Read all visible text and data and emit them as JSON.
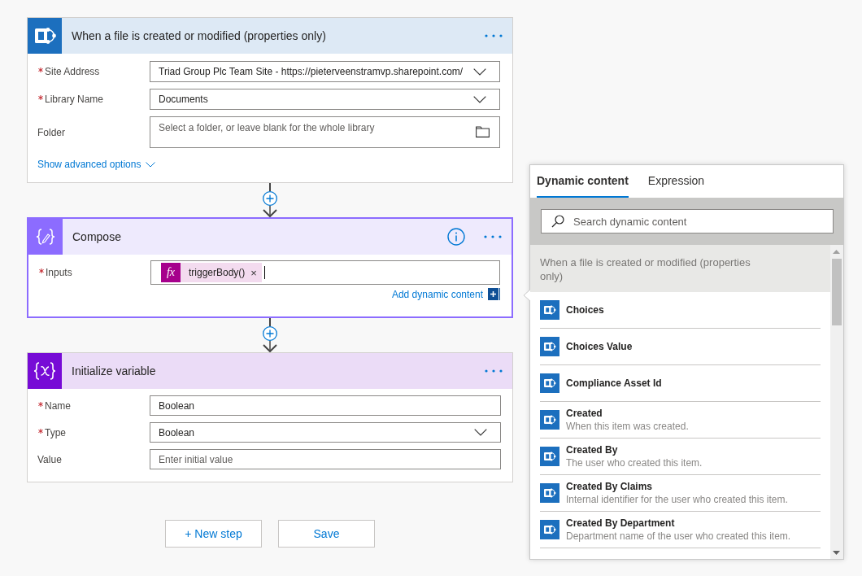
{
  "steps": [
    {
      "kind": "sharepoint",
      "title": "When a file is created or modified (properties only)",
      "selected": false,
      "fields": [
        {
          "kind": "dropdown",
          "label": "Site Address",
          "required": true,
          "value": "Triad Group Plc Team Site - https://pieterveenstramvp.sharepoint.com/"
        },
        {
          "kind": "dropdown",
          "label": "Library Name",
          "required": true,
          "value": "Documents"
        },
        {
          "kind": "folder",
          "label": "Folder",
          "required": false,
          "placeholder": "Select a folder, or leave blank for the whole library"
        }
      ],
      "link": "Show advanced options"
    },
    {
      "kind": "compose",
      "title": "Compose",
      "selected": true,
      "fields": [
        {
          "kind": "tokens",
          "label": "Inputs",
          "required": true,
          "focused": true,
          "tokens": [
            {
              "badge": "fx",
              "text": "triggerBody()",
              "remove": "×"
            }
          ],
          "link": "Add dynamic content"
        }
      ]
    },
    {
      "kind": "variable",
      "title": "Initialize variable",
      "selected": false,
      "fields": [
        {
          "kind": "text",
          "label": "Name",
          "required": true,
          "value": "Boolean"
        },
        {
          "kind": "dropdown",
          "label": "Type",
          "required": true,
          "value": "Boolean"
        },
        {
          "kind": "text",
          "label": "Value",
          "required": false,
          "placeholder": "Enter initial value"
        }
      ]
    }
  ],
  "buttons": [
    "+ New step",
    "Save"
  ],
  "panel": {
    "tabs": [
      {
        "label": "Dynamic content",
        "selected": true
      },
      {
        "label": "Expression",
        "selected": false
      }
    ],
    "search": {
      "placeholder": "Search dynamic content"
    },
    "groups": [
      {
        "title": "When a file is created or modified (properties only)",
        "items": [
          {
            "name": "Choices"
          },
          {
            "name": "Choices Value"
          },
          {
            "name": "Compliance Asset Id"
          },
          {
            "name": "Created",
            "description": "When this item was created."
          },
          {
            "name": "Created By",
            "description": "The user who created this item."
          },
          {
            "name": "Created By Claims",
            "description": "Internal identifier for the user who created this item."
          },
          {
            "name": "Created By Department",
            "description": "Department name of the user who created this item."
          }
        ]
      }
    ]
  }
}
